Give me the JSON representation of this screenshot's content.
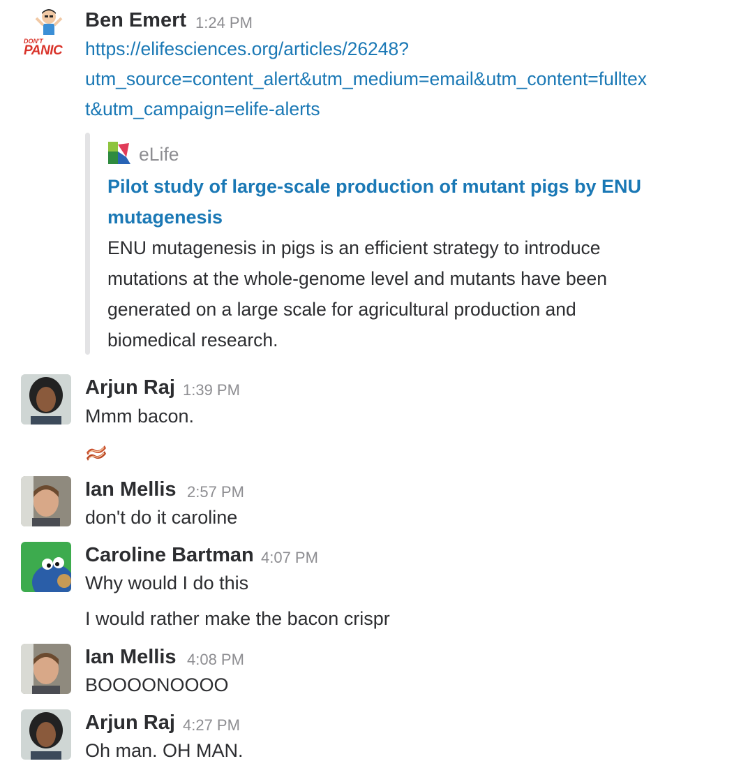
{
  "messages": [
    {
      "author": "Ben Emert",
      "time": "1:24 PM",
      "link_lines": [
        "https://elifesciences.org/articles/26248?",
        "utm_source=content_alert&utm_medium=email&utm_content=fulltex",
        "t&utm_campaign=elife-alerts"
      ],
      "avatar_text": [
        "DON'T",
        "PANIC"
      ],
      "attachment": {
        "source": "eLife",
        "title_lines": [
          "Pilot study of large-scale production of mutant pigs by ENU",
          "mutagenesis"
        ],
        "description_lines": [
          "ENU mutagenesis in pigs is an efficient strategy to introduce",
          "mutations at the whole-genome level and mutants have been",
          "generated on a large scale for agricultural production and",
          "biomedical research."
        ]
      }
    },
    {
      "author": "Arjun Raj",
      "time": "1:39 PM",
      "lines": [
        "Mmm bacon."
      ],
      "reaction_icon": "bacon-emoji"
    },
    {
      "author": "Ian Mellis",
      "time": "2:57 PM",
      "lines": [
        "don't do it caroline"
      ]
    },
    {
      "author": "Caroline Bartman",
      "time": "4:07 PM",
      "lines": [
        "Why would I do this",
        "I would rather make the bacon crispr"
      ]
    },
    {
      "author": "Ian Mellis",
      "time": "4:08 PM",
      "lines": [
        "BOOOONOOOO"
      ]
    },
    {
      "author": "Arjun Raj",
      "time": "4:27 PM",
      "lines": [
        "Oh man. OH MAN."
      ]
    }
  ],
  "colors": {
    "link": "#1a78b5",
    "timestamp": "#8d8d91",
    "text": "#2c2d30",
    "attachment_bar": "#e3e3e5"
  }
}
